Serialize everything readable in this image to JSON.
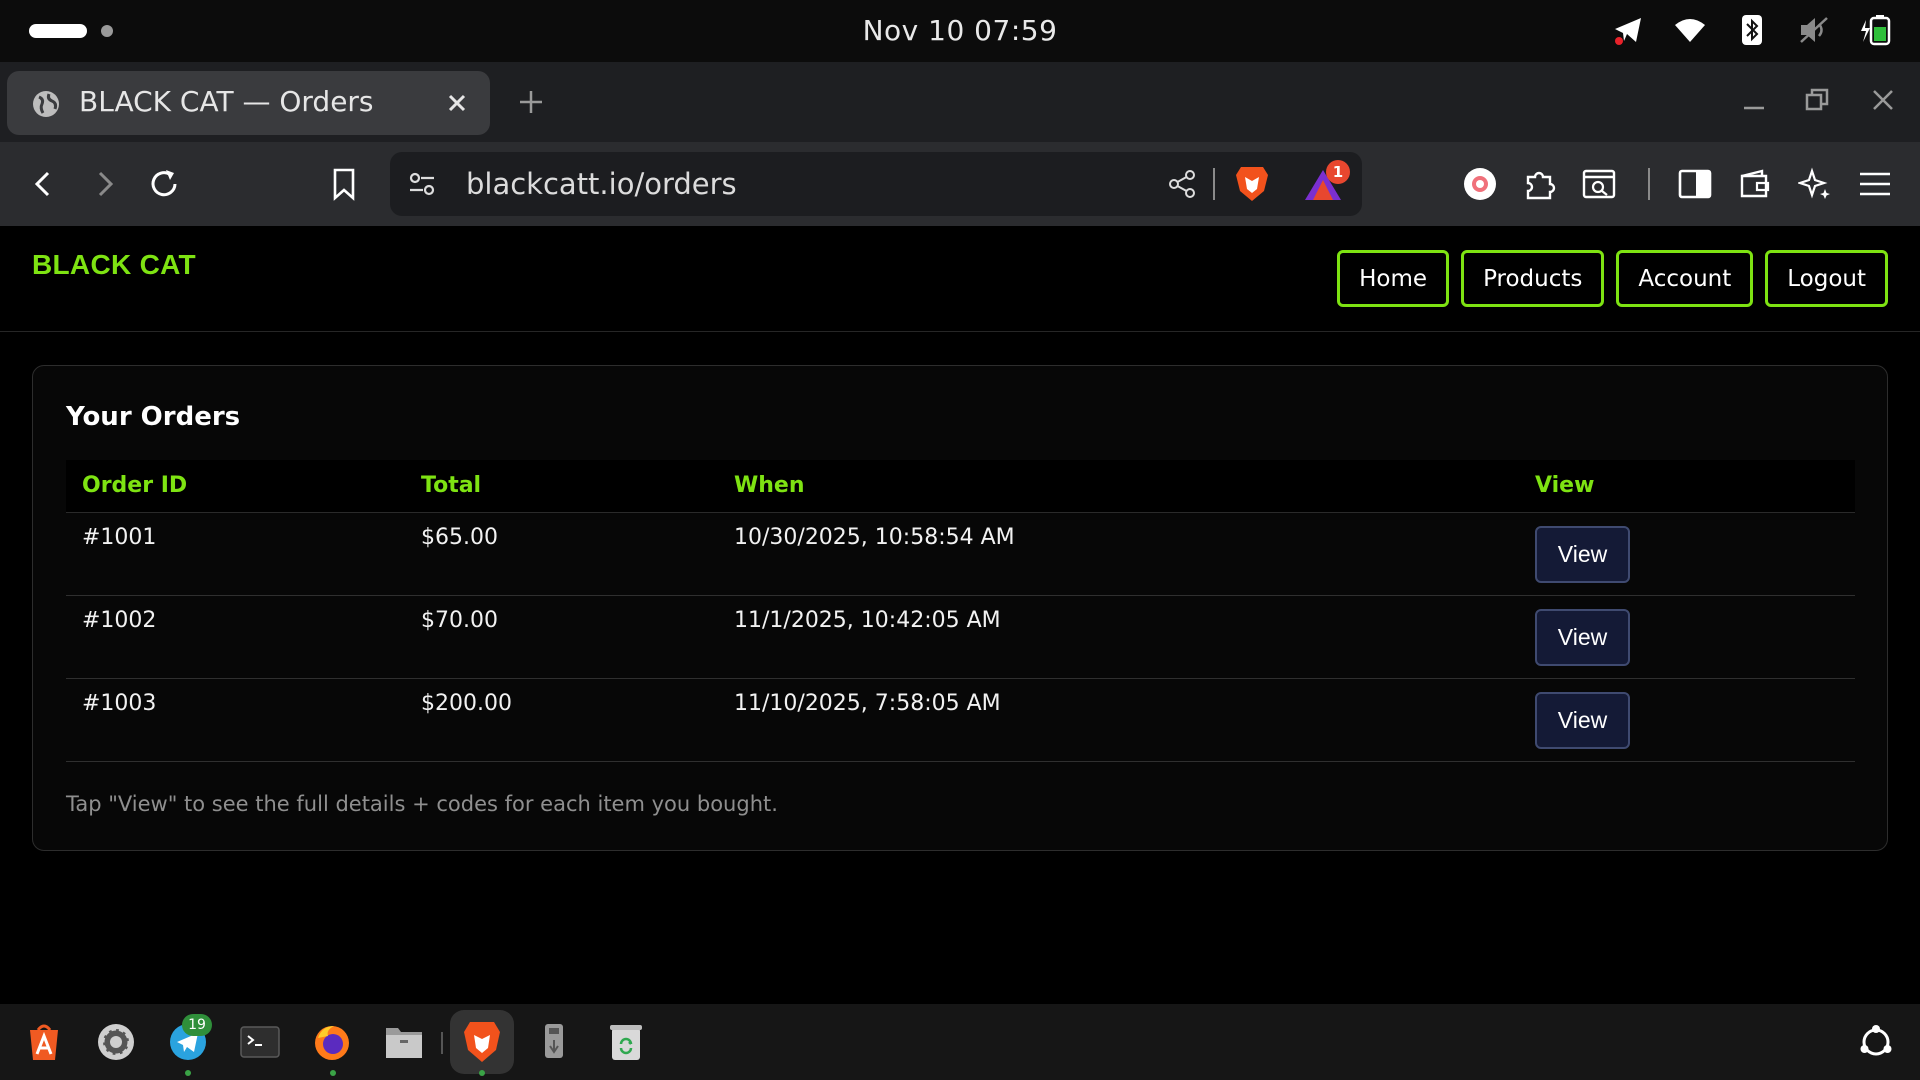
{
  "os": {
    "clock": "Nov 10  07:59"
  },
  "browser": {
    "tab_title": "BLACK CAT — Orders",
    "url": "blackcatt.io/orders",
    "notification_count": "1"
  },
  "site": {
    "brand": "BLACK CAT",
    "nav": [
      "Home",
      "Products",
      "Account",
      "Logout"
    ]
  },
  "orders": {
    "title": "Your Orders",
    "columns": [
      "Order ID",
      "Total",
      "When",
      "View"
    ],
    "rows": [
      {
        "id": "#1001",
        "total": "$65.00",
        "when": "10/30/2025, 10:58:54 AM",
        "action": "View"
      },
      {
        "id": "#1002",
        "total": "$70.00",
        "when": "11/1/2025, 10:42:05 AM",
        "action": "View"
      },
      {
        "id": "#1003",
        "total": "$200.00",
        "when": "11/10/2025, 7:58:05 AM",
        "action": "View"
      }
    ],
    "hint": "Tap \"View\" to see the full details + codes for each item you bought."
  },
  "dock": {
    "telegram_badge": "19"
  },
  "colors": {
    "accent": "#7ee312",
    "view_button_bg": "#141a36",
    "background": "#000000"
  }
}
